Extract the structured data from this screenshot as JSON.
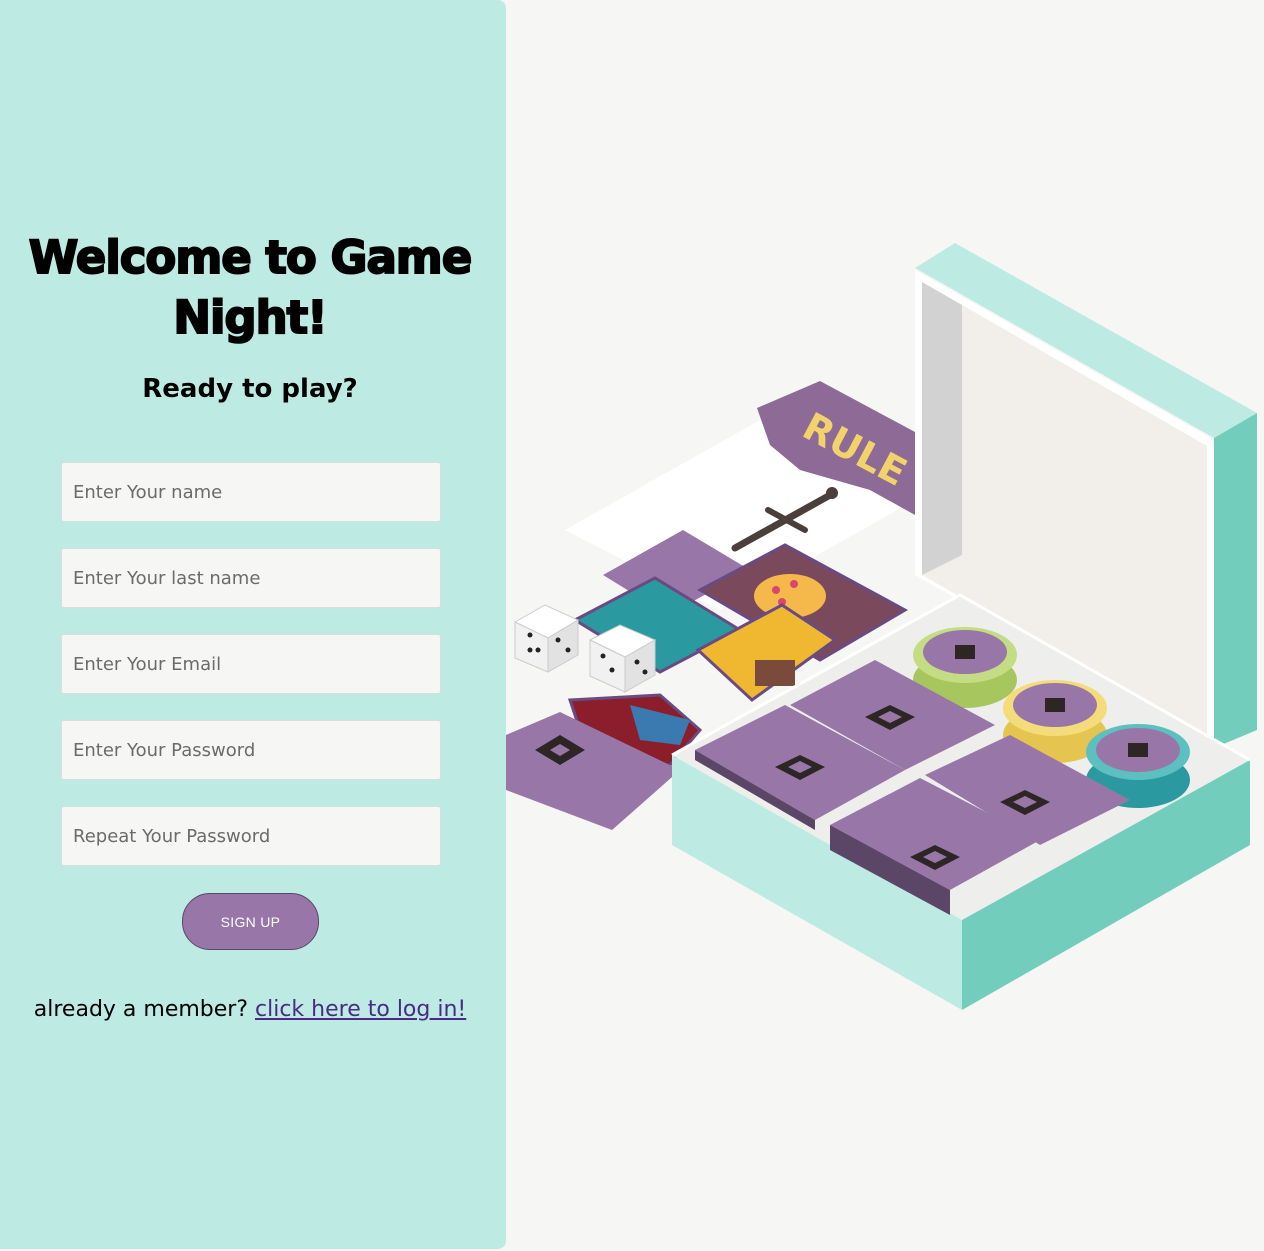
{
  "signup": {
    "title": "Welcome to Game Night!",
    "subtitle": "Ready to play?",
    "fields": {
      "first_name_placeholder": "Enter Your name",
      "last_name_placeholder": "Enter Your last name",
      "email_placeholder": "Enter Your Email",
      "password_placeholder": "Enter Your Password",
      "repeat_password_placeholder": "Repeat Your Password"
    },
    "signup_button": "SIGN UP",
    "member_text": "already a member?",
    "login_link": "click here to log in!"
  },
  "illustration": {
    "rules_label": "RULE"
  },
  "colors": {
    "panel": "#bdebe4",
    "background": "#f6f6f4",
    "button": "#9877a8",
    "link": "#4b2a86",
    "box_side": "#72cdbd",
    "card_purple": "#9877a8"
  }
}
